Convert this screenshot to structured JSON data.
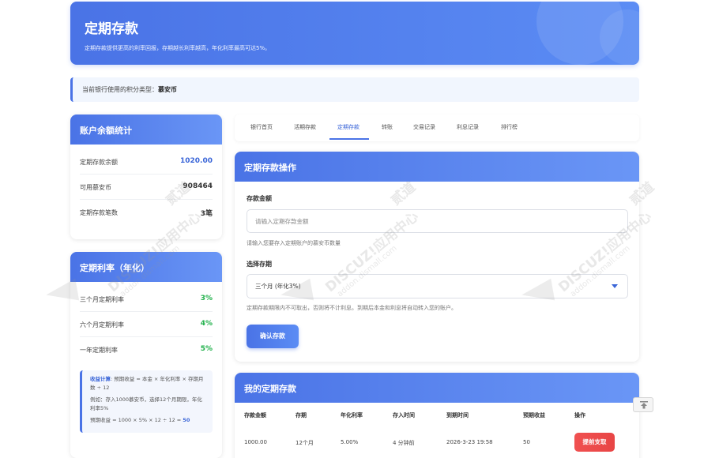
{
  "header": {
    "title": "定期存款",
    "subtitle": "定期存款提供更高的利率回报，存期越长利率越高，年化利率最高可达5%。"
  },
  "info_bar": {
    "label": "当前银行使用的积分类型：",
    "currency": "慕安币"
  },
  "balance_card": {
    "title": "账户余额统计",
    "rows": [
      {
        "label": "定期存款余额",
        "value": "1020.00",
        "color": "#3b66d8"
      },
      {
        "label": "可用慕安币",
        "value": "908464",
        "color": "#333333"
      },
      {
        "label": "定期存款笔数",
        "value": "3笔",
        "color": "#333333"
      }
    ]
  },
  "rate_card": {
    "title": "定期利率（年化）",
    "rows": [
      {
        "label": "三个月定期利率",
        "value": "3%"
      },
      {
        "label": "六个月定期利率",
        "value": "4%"
      },
      {
        "label": "一年定期利率",
        "value": "5%"
      }
    ],
    "formula_label": "收益计算",
    "formula_text": ": 预期收益 = 本金 × 年化利率 × 存期月数 ÷ 12",
    "example": "例如：存入1000慕安币，选择12个月期限，年化利率5%",
    "result_prefix": "预期收益 = 1000 × 5% × 12 ÷ 12 = ",
    "result_value": "50"
  },
  "tabs": [
    {
      "label": "银行首页",
      "active": false
    },
    {
      "label": "活期存款",
      "active": false
    },
    {
      "label": "定期存款",
      "active": true
    },
    {
      "label": "转账",
      "active": false
    },
    {
      "label": "交易记录",
      "active": false
    },
    {
      "label": "利息记录",
      "active": false
    },
    {
      "label": "排行榜",
      "active": false
    }
  ],
  "deposit_form": {
    "title": "定期存款操作",
    "amount_label": "存款金额",
    "amount_placeholder": "请输入定期存款金额",
    "amount_hint": "请输入您要存入定期账户的慕安币数量",
    "term_label": "选择存期",
    "term_selected": "三个月 (年化3%)",
    "term_hint": "定期存款期限内不可取出，否则将不计利息。到期后本金和利息将自动转入您的账户。",
    "confirm_button": "确认存款"
  },
  "my_deposits": {
    "title": "我的定期存款",
    "columns": [
      "存款金额",
      "存期",
      "年化利率",
      "存入时间",
      "到期时间",
      "预期收益",
      "操作"
    ],
    "rows": [
      {
        "amount": "1000.00",
        "term": "12个月",
        "rate": "5.00%",
        "deposited": "4 分钟前",
        "due": "2026-3-23 19:58",
        "income": "50",
        "action": "提前支取"
      }
    ]
  },
  "watermark": {
    "brand": "DISCUZ!应用中心",
    "brand2": "贰道",
    "site": "addon.dismall.com"
  },
  "colors": {
    "accent": "#4a73e6",
    "positive": "#22b14c",
    "danger": "#e84545"
  }
}
